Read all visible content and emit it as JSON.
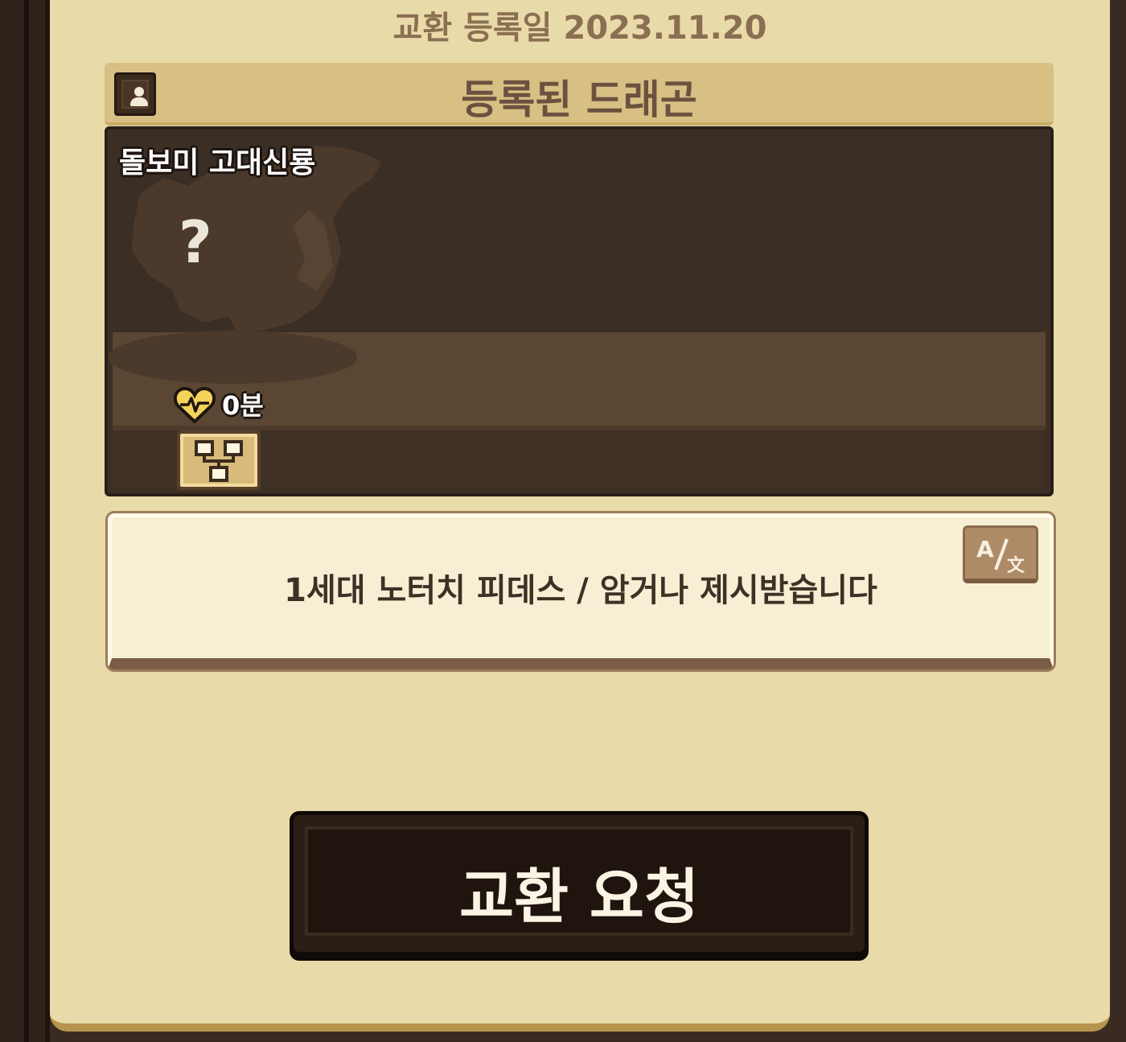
{
  "header": {
    "registration_date": "교환 등록일 2023.11.20"
  },
  "section": {
    "title": "등록된 드래곤"
  },
  "dragon": {
    "name": "돌보미 고대신룡",
    "unknown_mark": "?",
    "time": "0분"
  },
  "memo": {
    "text": "1세대 노터치 피데스 / 암거나 제시받습니다"
  },
  "actions": {
    "exchange_request": "교환 요청"
  },
  "colors": {
    "panel_bg": "#e9dba9",
    "header_bar": "#d8bf83",
    "card_bg": "#3b2e25",
    "button_bg": "#2a1e15"
  },
  "icons": {
    "profile": "profile-icon",
    "heart": "heart-pulse-icon",
    "tree": "family-tree-icon",
    "translate": "translate-icon"
  }
}
